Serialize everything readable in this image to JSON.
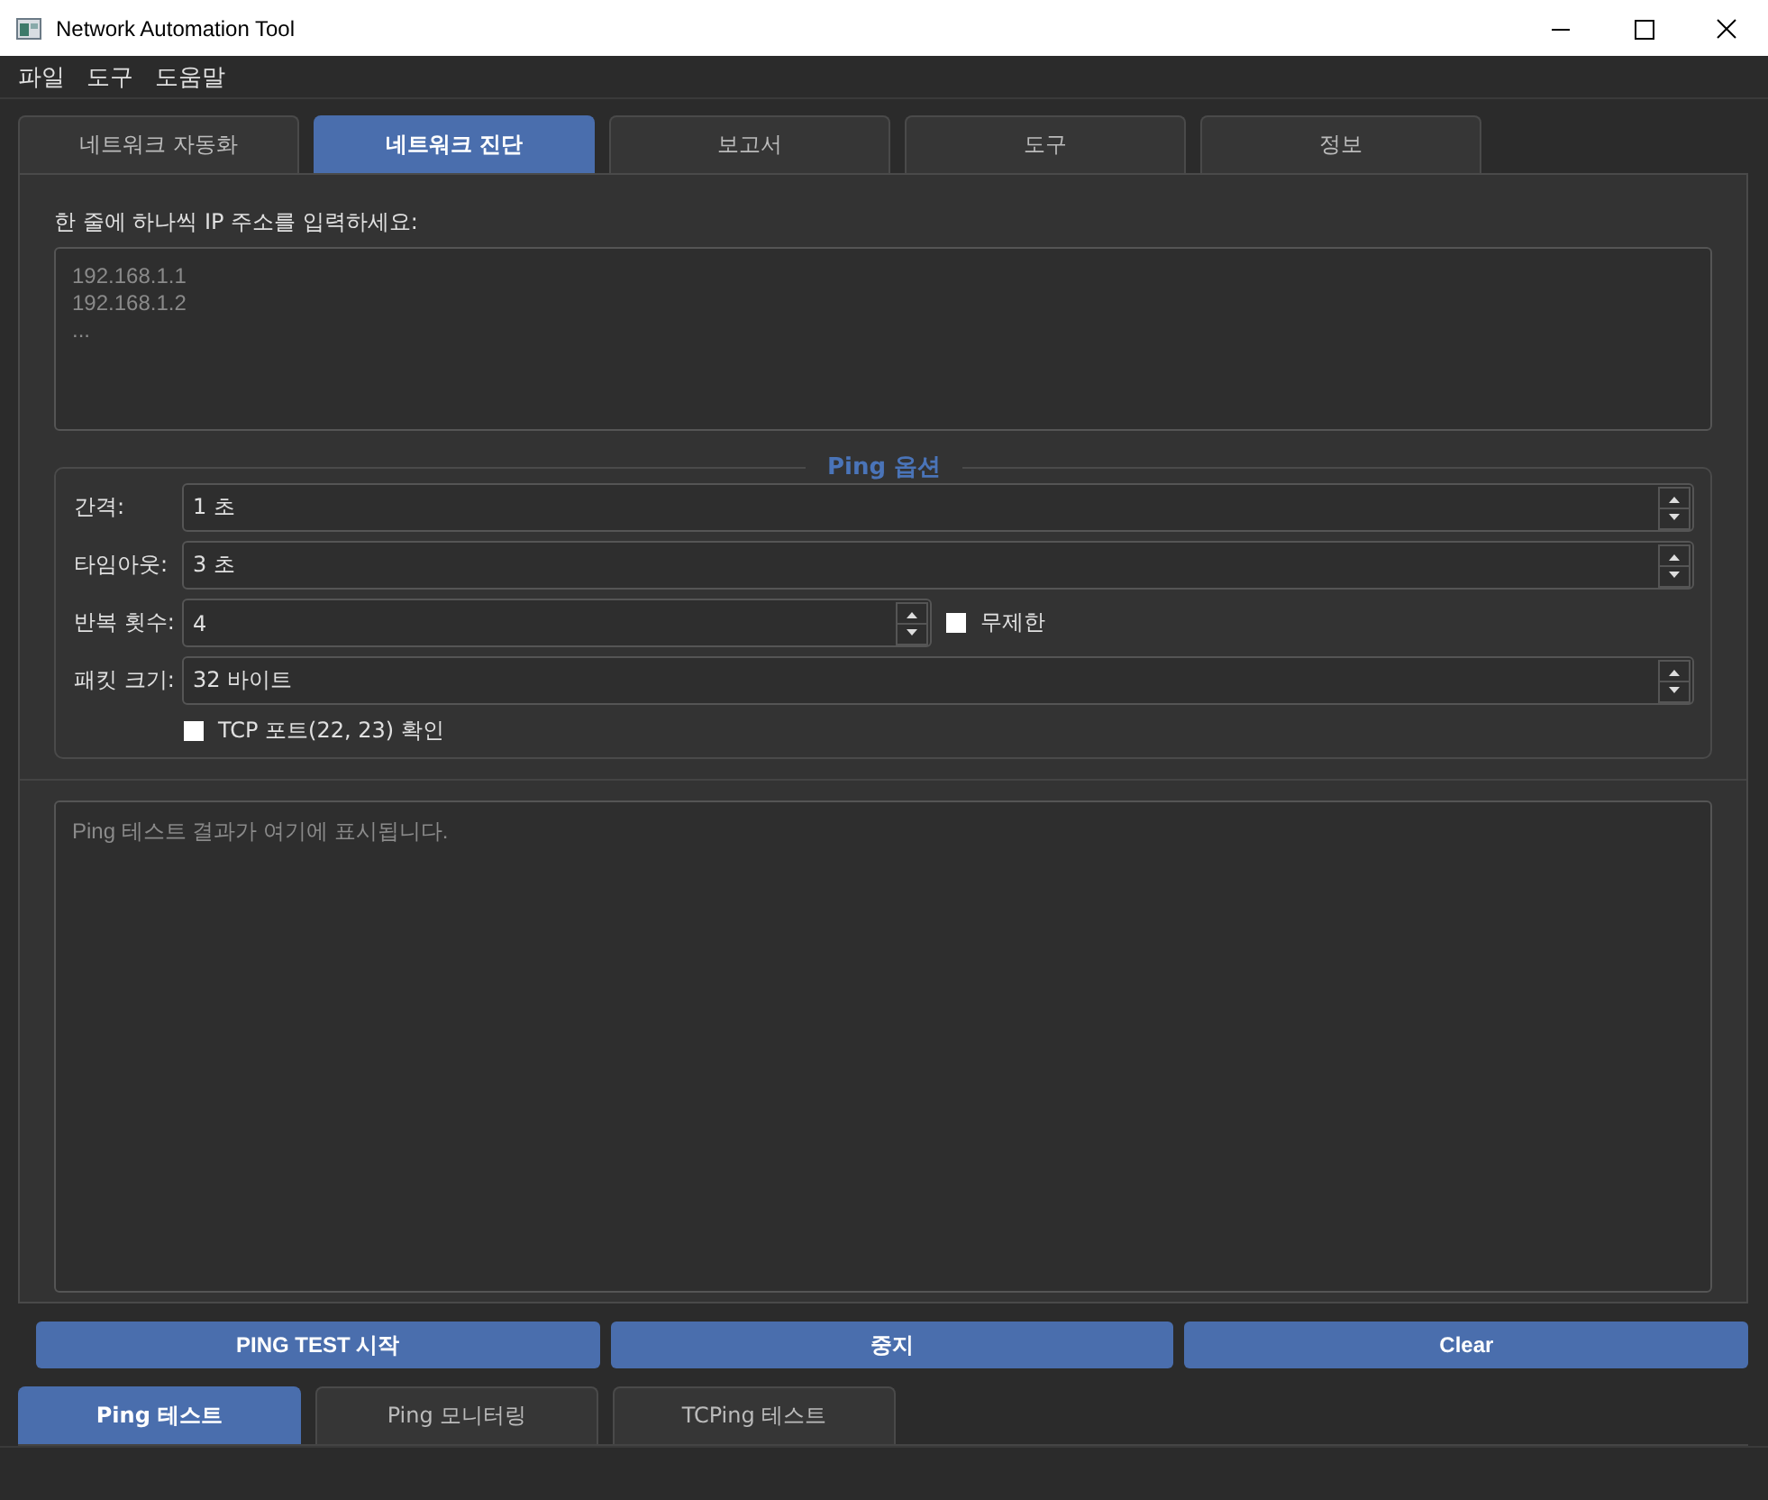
{
  "window": {
    "title": "Network Automation Tool"
  },
  "menu": [
    "파일",
    "도구",
    "도움말"
  ],
  "tabs": [
    {
      "label": "네트워크 자동화",
      "selected": false
    },
    {
      "label": "네트워크 진단",
      "selected": true
    },
    {
      "label": "보고서",
      "selected": false
    },
    {
      "label": "도구",
      "selected": false
    },
    {
      "label": "정보",
      "selected": false
    }
  ],
  "ip_input": {
    "label": "한 줄에 하나씩 IP 주소를 입력하세요:",
    "placeholder": "192.168.1.1\n192.168.1.2\n..."
  },
  "ping_options": {
    "title": "Ping 옵션",
    "fields": [
      {
        "label": "간격:",
        "value": "1 초"
      },
      {
        "label": "타임아웃:",
        "value": "3 초"
      },
      {
        "label": "반복 횟수:",
        "value": "4",
        "checkbox": {
          "label": "무제한",
          "checked": false
        }
      },
      {
        "label": "패킷 크기:",
        "value": "32 바이트"
      }
    ],
    "tcp_check": {
      "label": "TCP 포트(22, 23) 확인",
      "checked": false
    }
  },
  "output": {
    "placeholder": "Ping 테스트 결과가 여기에 표시됩니다."
  },
  "buttons": [
    "PING TEST 시작",
    "중지",
    "Clear"
  ],
  "sub_tabs": [
    {
      "label": "Ping 테스트",
      "selected": true
    },
    {
      "label": "Ping 모니터링",
      "selected": false
    },
    {
      "label": "TCPing 테스트",
      "selected": false
    }
  ]
}
